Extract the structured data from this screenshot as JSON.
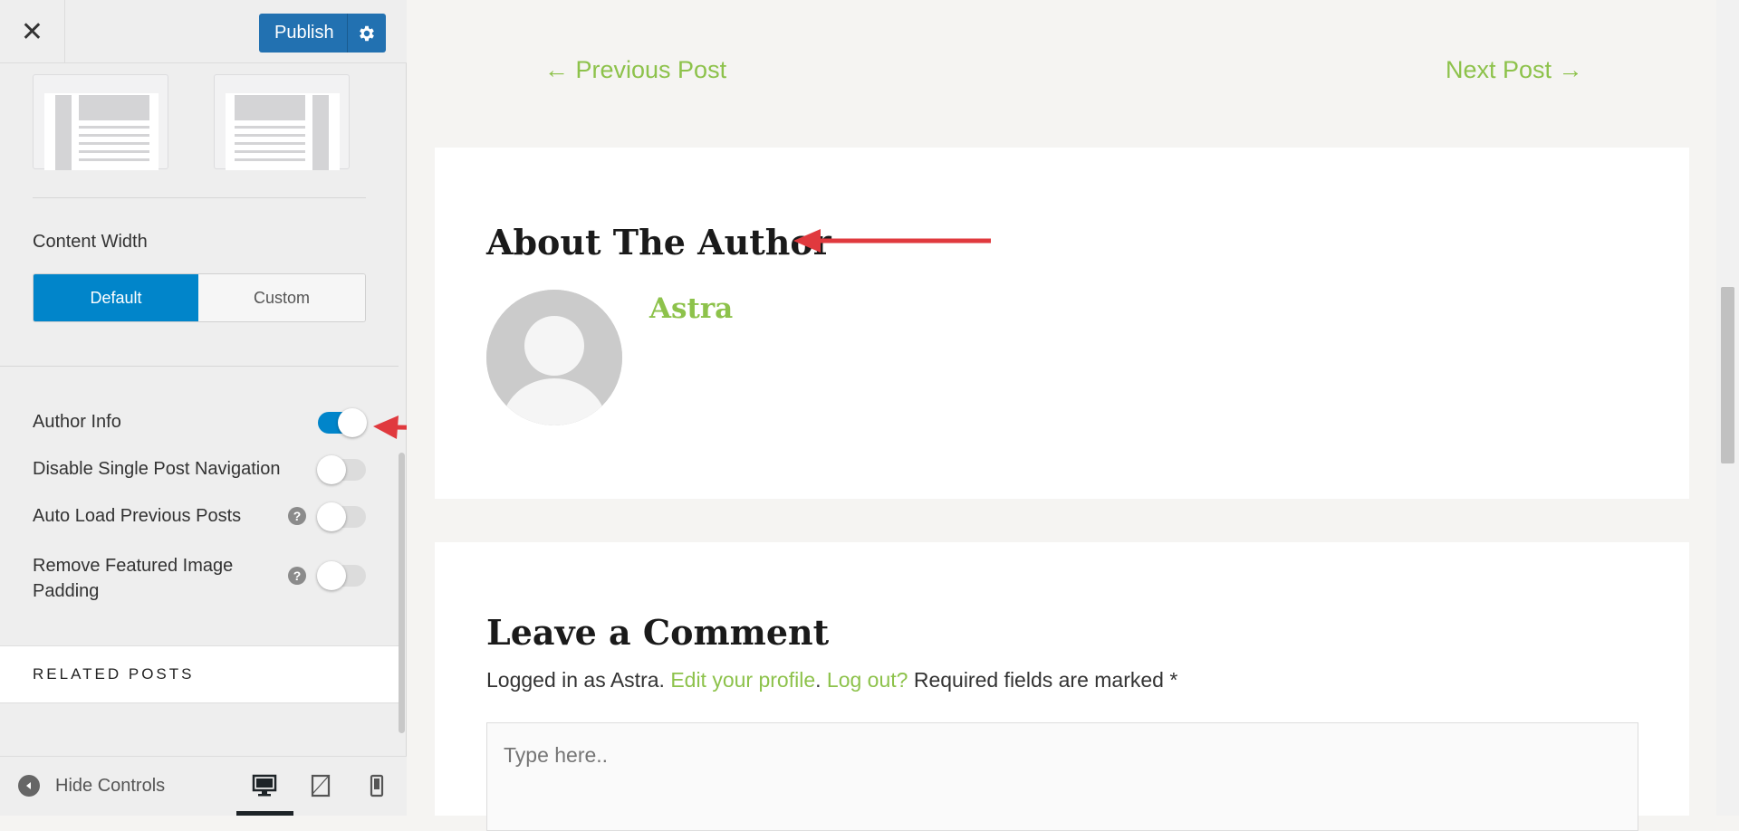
{
  "sidebar": {
    "close_icon": "close-icon",
    "publish_label": "Publish",
    "settings_icon": "gear-icon",
    "layout_options": [
      "left-sidebar-layout",
      "right-sidebar-layout"
    ],
    "content_width": {
      "label": "Content Width",
      "options": [
        "Default",
        "Custom"
      ],
      "selected": "Default"
    },
    "toggles": [
      {
        "label": "Author Info",
        "on": true,
        "help": false
      },
      {
        "label": "Disable Single Post Navigation",
        "on": false,
        "help": false
      },
      {
        "label": "Auto Load Previous Posts",
        "on": false,
        "help": true
      },
      {
        "label": "Remove Featured Image Padding",
        "on": false,
        "help": true
      }
    ],
    "help_glyph": "?",
    "related_posts": "RELATED POSTS",
    "hide_controls": "Hide Controls",
    "devices": [
      "desktop-icon",
      "tablet-icon",
      "mobile-icon"
    ],
    "active_device": "desktop"
  },
  "preview": {
    "prev_post": "← Previous Post",
    "next_post": "Next Post →",
    "author_box": {
      "title": "About The Author",
      "author_name": "Astra"
    },
    "comments": {
      "title": "Leave a Comment",
      "logged_in_prefix": "Logged in as Astra.",
      "edit_profile": "Edit your profile",
      "separator": ".",
      "log_out": "Log out?",
      "required_note": "Required fields are marked *",
      "placeholder": "Type here.."
    }
  },
  "colors": {
    "accent": "#0185ca",
    "publish": "#2271b1",
    "link_green": "#8dc24b",
    "annotation_red": "#e0393e"
  }
}
